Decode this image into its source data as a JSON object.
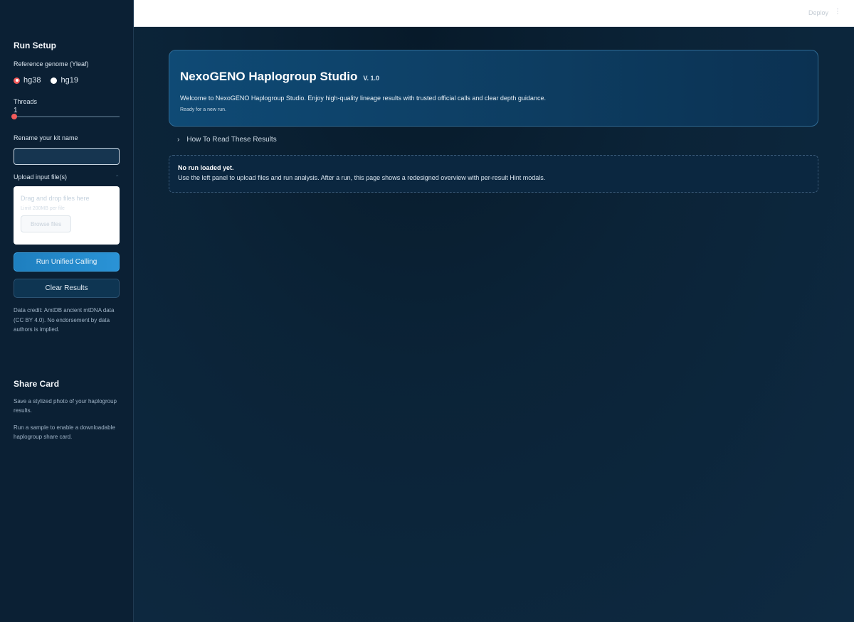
{
  "sidebar": {
    "heading": "Run Setup",
    "reference_label": "Reference genome (Yleaf)",
    "reference_options": [
      {
        "label": "hg38",
        "selected": true
      },
      {
        "label": "hg19",
        "selected": false
      }
    ],
    "threads_label": "Threads",
    "threads_value": "1",
    "kit_label": "Rename your kit name",
    "kit_value": "",
    "upload_label": "Upload input file(s)",
    "dropzone_title": "Drag and drop files here",
    "dropzone_limit": "Limit 200MB per file",
    "browse_label": "Browse files",
    "run_button": "Run Unified Calling",
    "clear_button": "Clear Results",
    "credit": "Data credit: AmtDB ancient mtDNA data (CC BY 4.0). No endorsement by data authors is implied.",
    "share_heading": "Share Card",
    "share_desc": "Save a stylized photo of your haplogroup results.",
    "share_hint": "Run a sample to enable a downloadable haplogroup share card."
  },
  "topbar": {
    "deploy_label": "Deploy",
    "menu_glyph": "⋮"
  },
  "hero": {
    "title": "NexoGENO Haplogroup Studio",
    "version": "V. 1.0",
    "welcome": "Welcome to NexoGENO Haplogroup Studio. Enjoy high-quality lineage results with trusted official calls and clear depth guidance.",
    "status": "Ready for a new run."
  },
  "expander": {
    "label": "How To Read These Results"
  },
  "notice": {
    "title": "No run loaded yet.",
    "body": "Use the left panel to upload files and run analysis. After a run, this page shows a redesigned overview with per-result Hint modals."
  },
  "colors": {
    "accent_red": "#f25b5b",
    "primary_blue": "#1e7fbf",
    "sidebar_bg": "#0b2034",
    "main_bg": "#0c2237"
  }
}
